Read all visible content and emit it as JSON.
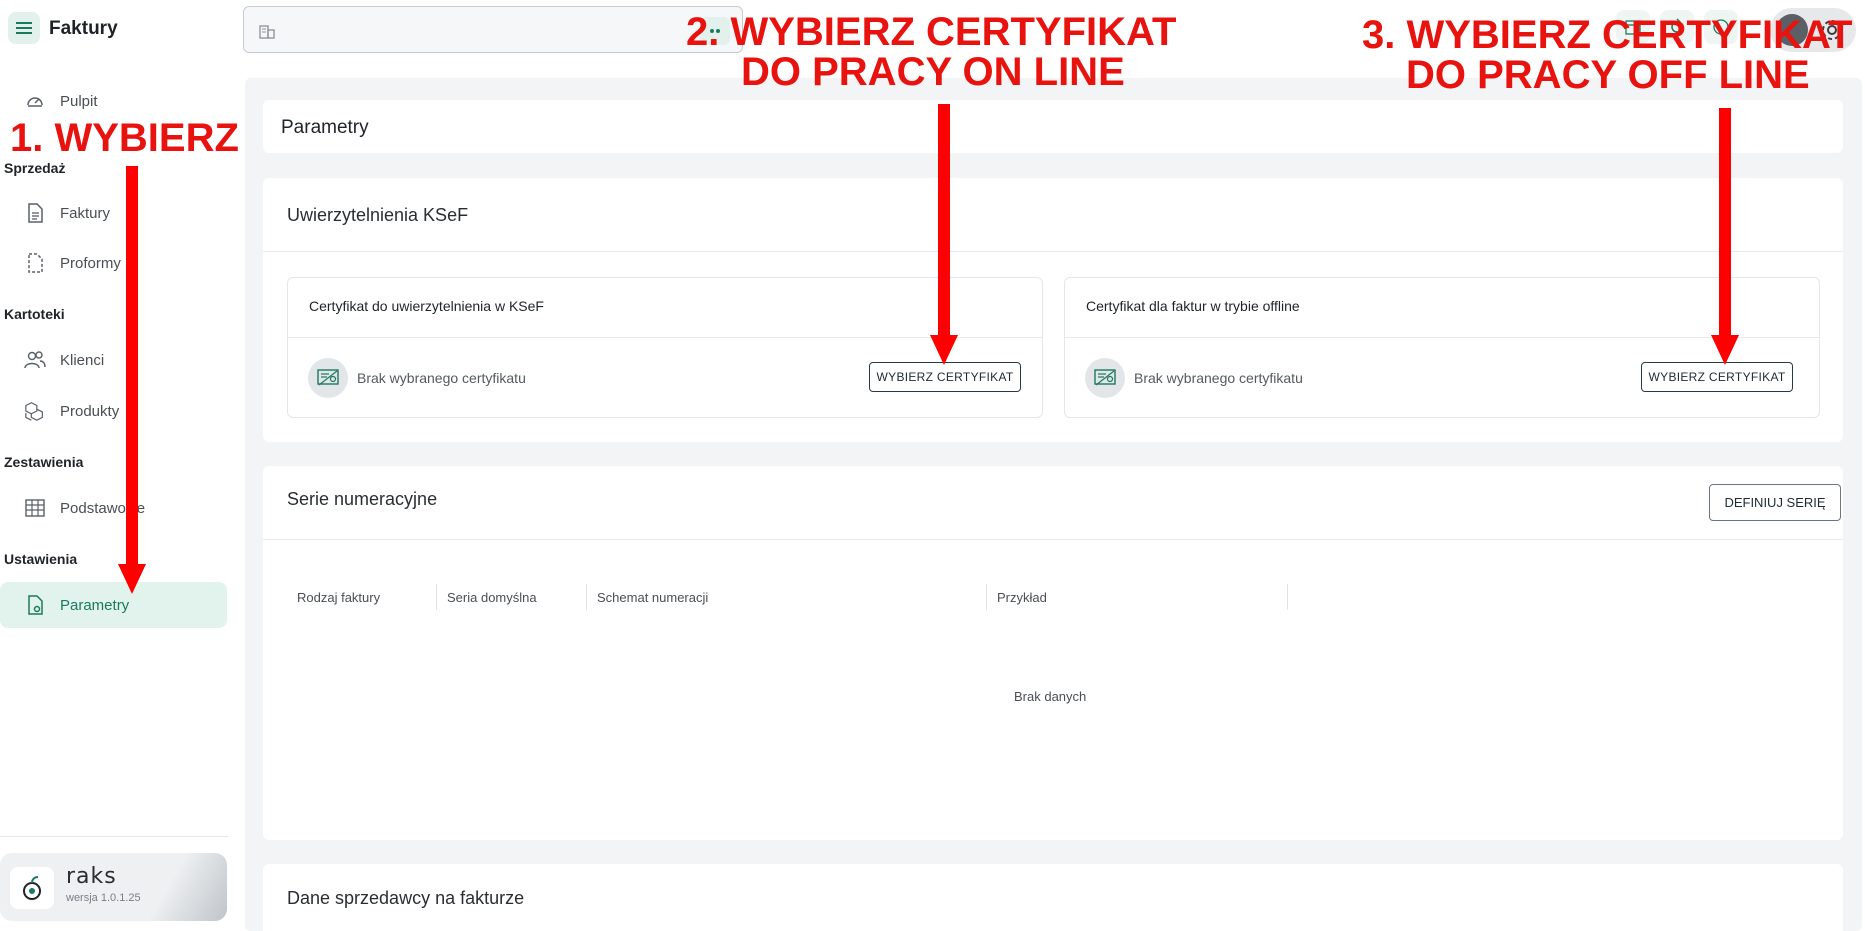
{
  "app": {
    "title": "Faktury",
    "brand_name": "raks",
    "version": "wersja 1.0.1.25"
  },
  "sidebar": {
    "sections": [
      "Sprzedaż",
      "Kartoteki",
      "Zestawienia",
      "Ustawienia"
    ],
    "items": [
      {
        "label": "Pulpit",
        "icon": "gauge-icon"
      },
      {
        "label": "Faktury",
        "icon": "document-icon"
      },
      {
        "label": "Proformy",
        "icon": "dashed-document-icon"
      },
      {
        "label": "Klienci",
        "icon": "users-icon"
      },
      {
        "label": "Produkty",
        "icon": "boxes-icon"
      },
      {
        "label": "Podstawowe",
        "icon": "table-icon"
      },
      {
        "label": "Parametry",
        "icon": "settings-document-icon",
        "active": true
      }
    ]
  },
  "main": {
    "page_title": "Parametry",
    "ksef": {
      "heading": "Uwierzytelnienia KSeF",
      "online": {
        "title": "Certyfikat do uwierzytelnienia w KSeF",
        "status": "Brak wybranego certyfikatu",
        "button": "WYBIERZ CERTYFIKAT"
      },
      "offline": {
        "title": "Certyfikat dla faktur w trybie offline",
        "status": "Brak wybranego certyfikatu",
        "button": "WYBIERZ CERTYFIKAT"
      }
    },
    "series": {
      "heading": "Serie numeracyjne",
      "button": "DEFINIUJ SERIĘ",
      "columns": [
        "Rodzaj faktury",
        "Seria domyślna",
        "Schemat numeracji",
        "Przykład"
      ],
      "empty": "Brak danych"
    },
    "seller": {
      "heading": "Dane sprzedawcy na fakturze"
    }
  },
  "annotations": {
    "step1": "1. WYBIERZ",
    "step2_line1": "2. WYBIERZ CERTYFIKAT",
    "step2_line2": "DO PRACY ON LINE",
    "step3_line1": "3. WYBIERZ CERTYFIKAT",
    "step3_line2": "DO PRACY OFF LINE",
    "color": "#ff0000"
  },
  "colors": {
    "accent": "#1b7a5e",
    "accent_bg": "#e2f3ee",
    "main_bg": "#f3f4f5"
  }
}
